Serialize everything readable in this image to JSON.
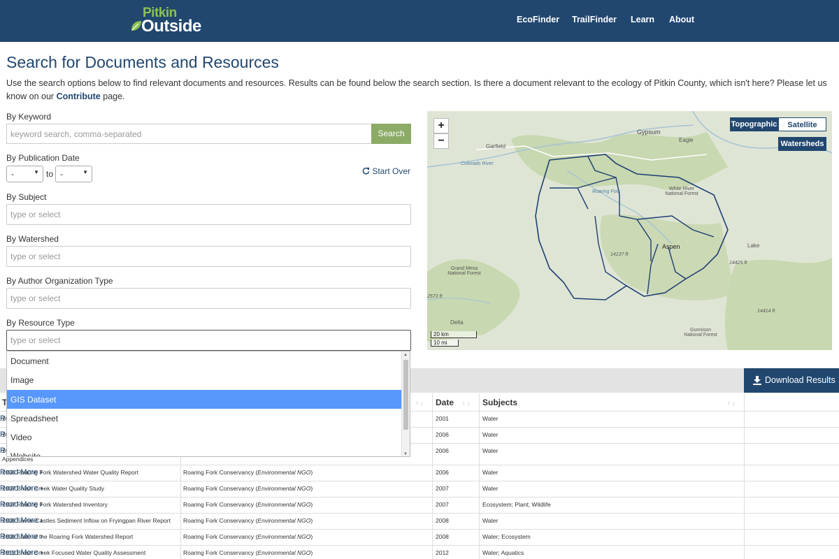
{
  "header": {
    "logo_line1": "Pitkin",
    "logo_line2": "Outside",
    "nav": [
      "EcoFinder",
      "TrailFinder",
      "Learn",
      "About"
    ]
  },
  "page": {
    "title": "Search for Documents and Resources",
    "intro_before": "Use the search options below to find relevant documents and resources. Results can be found below the search section. Is there a document relevant to the ecology of Pitkin County, which isn't here? Please let us know on our ",
    "intro_link": "Contribute",
    "intro_after": " page."
  },
  "filters": {
    "keyword_label": "By Keyword",
    "keyword_placeholder": "keyword search, comma-separated",
    "search_button": "Search",
    "pubdate_label": "By Publication Date",
    "date_from": "-",
    "date_to_word": "to",
    "date_to": "-",
    "start_over": "Start Over",
    "subject_label": "By Subject",
    "subject_placeholder": "type or select",
    "watershed_label": "By Watershed",
    "watershed_placeholder": "type or select",
    "author_label": "By Author Organization Type",
    "author_placeholder": "type or select",
    "resource_label": "By Resource Type",
    "resource_placeholder": "type or select",
    "resource_options": [
      "Document",
      "Image",
      "GIS Dataset",
      "Spreadsheet",
      "Video",
      "Website"
    ],
    "resource_highlighted": "GIS Dataset"
  },
  "map": {
    "zoom_in": "+",
    "zoom_out": "−",
    "basemap_topographic": "Topographic",
    "basemap_satellite": "Satellite",
    "layer_watersheds": "Watersheds",
    "scale_km": "20 km",
    "scale_mi": "10 mi",
    "place_labels": [
      "Gypsum",
      "Eagle",
      "Garfield",
      "Colorado River",
      "Roaring Fork",
      "White River National Forest",
      "Aspen",
      "Grand Mesa National Forest",
      "Gunnison National Forest",
      "Delta",
      "Lake",
      "14137 ft",
      "14425 ft",
      "14414 ft",
      "2573 ft"
    ],
    "colors": {
      "water": "#a6c3d4",
      "watershed_line": "#1e3f73",
      "forest": "#c8d8b0"
    }
  },
  "results": {
    "download_button": "Download Results",
    "columns": [
      "T",
      "Date",
      "Subjects"
    ],
    "rows": [
      {
        "title": "20",
        "author": "",
        "org_type": "",
        "date": "2001",
        "subjects": "Water"
      },
      {
        "title": "20",
        "author": "",
        "org_type": "",
        "date": "2006",
        "subjects": "Water"
      },
      {
        "title": "20",
        "author": "",
        "org_type": "",
        "date": "2006",
        "subjects": "Water",
        "extra": "Appendices"
      },
      {
        "title": "2006 Roaring Fork Watershed Water Quality Report",
        "author": "Roaring Fork Conservancy (",
        "org_type": "Environmental NGO",
        "date": "2006",
        "subjects": "Water"
      },
      {
        "title": "2007 Brush Creek Water Quality Study",
        "author": "Roaring Fork Conservancy (",
        "org_type": "Environmental NGO",
        "date": "2007",
        "subjects": "Water"
      },
      {
        "title": "2007 Roaring Fork Watershed Inventory",
        "author": "Roaring Fork Conservancy (",
        "org_type": "Environmental NGO",
        "date": "2007",
        "subjects": "Ecosystem; Plant; Wildlife"
      },
      {
        "title": "2008 Seven Castles Sediment Inflow on Fryingpan River Report",
        "author": "Roaring Fork Conservancy (",
        "org_type": "Environmental NGO",
        "date": "2008",
        "subjects": "Water"
      },
      {
        "title": "2008 State of the Roaring Fork Watershed Report",
        "author": "Roaring Fork Conservancy (",
        "org_type": "Environmental NGO",
        "date": "2008",
        "subjects": "Water; Ecosystem"
      },
      {
        "title": "2012 Brush Creek Focused Water Quality Assessment",
        "author": "Roaring Fork Conservancy (",
        "org_type": "Environmental NGO",
        "date": "2012",
        "subjects": "Water; Aquatics"
      }
    ],
    "read_more": "Read More"
  }
}
